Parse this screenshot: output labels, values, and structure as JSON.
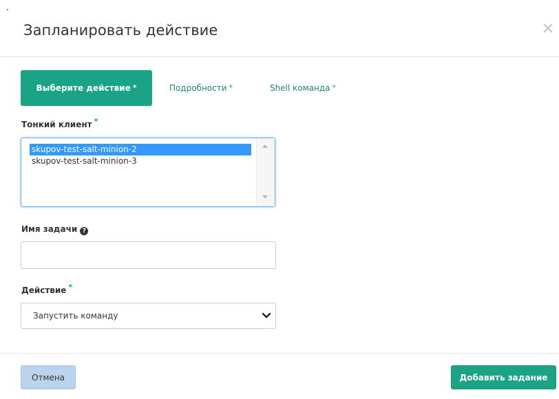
{
  "modal": {
    "title": "Запланировать действие",
    "close_icon": "close-icon"
  },
  "tabs": [
    {
      "label": "Выберите действие",
      "required_mark": "*",
      "active": true
    },
    {
      "label": "Подробности",
      "required_mark": "*",
      "active": false
    },
    {
      "label": "Shell команда",
      "required_mark": "*",
      "active": false
    }
  ],
  "thin_client": {
    "label": "Тонкий клиент",
    "required_mark": "*",
    "options": [
      {
        "text": "skupov-test-salt-minion-2",
        "selected": true
      },
      {
        "text": "skupov-test-salt-minion-3",
        "selected": false
      }
    ]
  },
  "task_name": {
    "label": "Имя задачи",
    "help_icon": "question-circle-icon",
    "help_glyph": "?",
    "value": "",
    "placeholder": ""
  },
  "action": {
    "label": "Действие",
    "required_mark": "*",
    "selected_value": "Запустить команду",
    "chevron_icon": "chevron-down-icon"
  },
  "footer": {
    "cancel_label": "Отмена",
    "submit_label": "Добавить задание"
  },
  "colors": {
    "accent": "#1aa385",
    "selection": "#3399ff",
    "cancel_bg": "#bcd3ee"
  }
}
